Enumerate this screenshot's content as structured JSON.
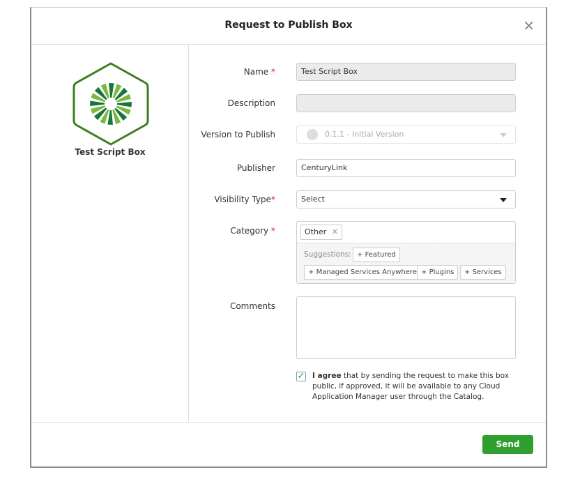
{
  "dialog": {
    "title": "Request to Publish Box",
    "close_icon": "close-icon"
  },
  "box": {
    "name": "Test Script Box",
    "colors": {
      "hex": "#3d7d1e",
      "dark": "#17773a",
      "light": "#7ab83e"
    }
  },
  "form": {
    "name_label": "Name",
    "name_value": "Test Script Box",
    "description_label": "Description",
    "description_value": "",
    "version_label": "Version to Publish",
    "version_value": "0.1.1 - Initial Version",
    "publisher_label": "Publisher",
    "publisher_value": "CenturyLink",
    "visibility_label": "Visibility Type",
    "visibility_value": "Select",
    "category_label": "Category",
    "category_tags": [
      "Other"
    ],
    "suggestions_label": "Suggestions:",
    "suggestions": [
      "Featured",
      "Managed Services Anywhere",
      "Plugins",
      "Services"
    ],
    "comments_label": "Comments",
    "comments_value": "",
    "required_mark": "*",
    "agree_bold": "I agree",
    "agree_text": " that by sending the request to make this box public, if approved, it will be available to any Cloud Application Manager user through the Catalog.",
    "agree_checked": true
  },
  "footer": {
    "send_label": "Send",
    "accent": "#2fa02f"
  }
}
